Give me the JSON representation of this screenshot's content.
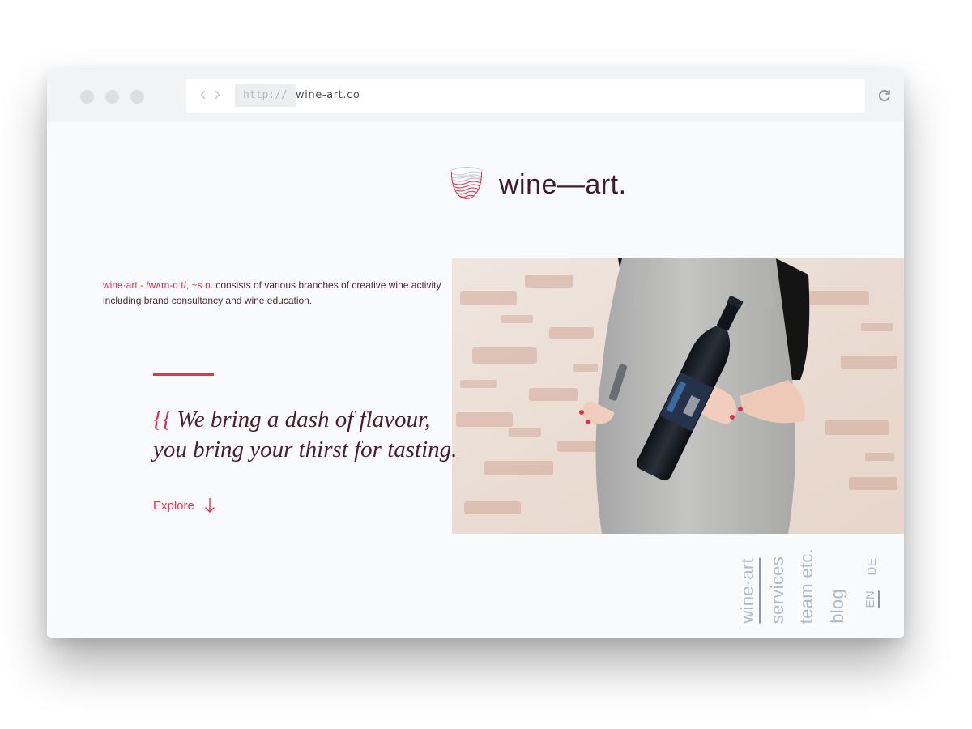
{
  "browser": {
    "protocol": "http://",
    "domain": "wine-art.co"
  },
  "brand": {
    "logo_text": "wine—art."
  },
  "definition": {
    "term": "wine·art - /wʌɪn-ɑːt/, ~s n.",
    "text": " consists of various branches of creative wine activity including brand consultancy and wine education."
  },
  "hero": {
    "brace": "{{",
    "line1": "We bring a dash of flavour,",
    "line2": "you bring your thirst for tasting.",
    "cta_label": "Explore"
  },
  "nav": {
    "items": [
      {
        "label": "wine·art"
      },
      {
        "label": "services"
      },
      {
        "label": "team etc."
      },
      {
        "label": "blog"
      }
    ],
    "languages": [
      {
        "label": "EN"
      },
      {
        "label": "DE"
      }
    ]
  },
  "colors": {
    "accent": "#e0334f",
    "brand_dark": "#3e1d24",
    "nav_gray": "#b0b9c9"
  }
}
